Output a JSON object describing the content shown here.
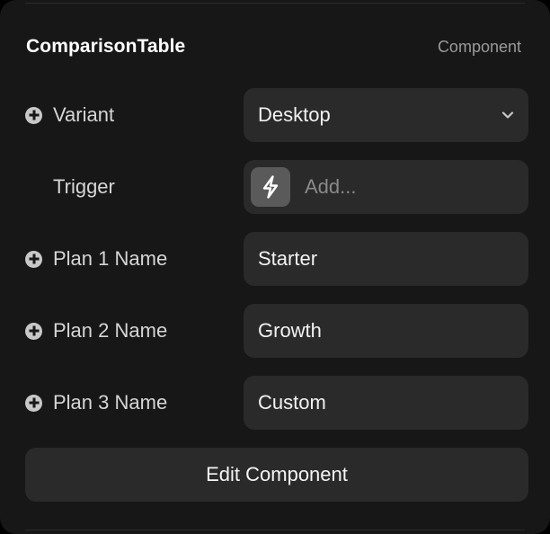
{
  "header": {
    "title": "ComparisonTable",
    "kind": "Component"
  },
  "rows": [
    {
      "label": "Variant",
      "value": "Desktop",
      "icon": "plus-circle-icon",
      "control": "select"
    },
    {
      "label": "Trigger",
      "placeholder": "Add...",
      "icon": "lightning-bolt-icon",
      "control": "trigger"
    },
    {
      "label": "Plan 1 Name",
      "value": "Starter",
      "icon": "plus-circle-icon",
      "control": "text"
    },
    {
      "label": "Plan 2 Name",
      "value": "Growth",
      "icon": "plus-circle-icon",
      "control": "text"
    },
    {
      "label": "Plan 3 Name",
      "value": "Custom",
      "icon": "plus-circle-icon",
      "control": "text"
    }
  ],
  "actions": {
    "edit_label": "Edit Component"
  },
  "colors": {
    "panel": "#171717",
    "field": "#2a2a2a",
    "text": "#f2f2f2",
    "muted": "#9a9a9a"
  }
}
